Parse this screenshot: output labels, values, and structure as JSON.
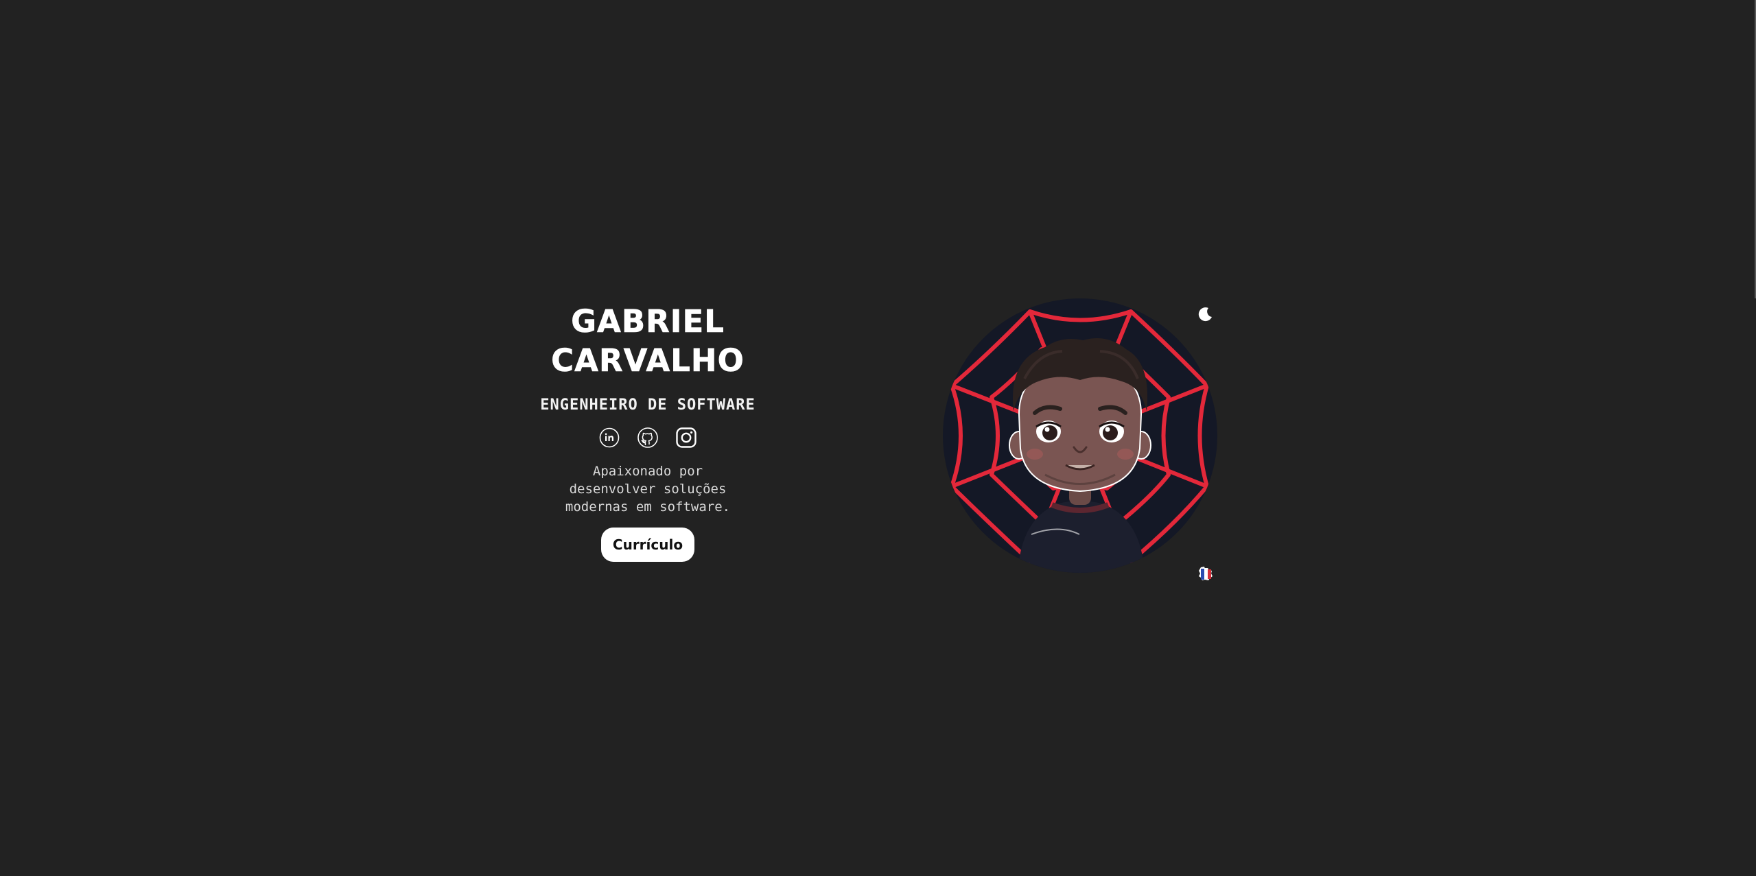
{
  "profile": {
    "name_line1": "GABRIEL",
    "name_line2": "CARVALHO",
    "role": "ENGENHEIRO DE SOFTWARE",
    "bio_line1": "Apaixonado por",
    "bio_line2": "desenvolver soluções",
    "bio_line3": "modernas em software.",
    "cv_label": "Currículo"
  },
  "socials": [
    {
      "icon": "linkedin-icon"
    },
    {
      "icon": "github-icon"
    },
    {
      "icon": "instagram-icon"
    }
  ],
  "controls": {
    "theme_icon": "moon-icon",
    "language_icon": "flag-france-icon"
  },
  "colors": {
    "background": "#222222",
    "text": "#ffffff",
    "web_red": "#e3283a",
    "avatar_bg": "#141826"
  }
}
